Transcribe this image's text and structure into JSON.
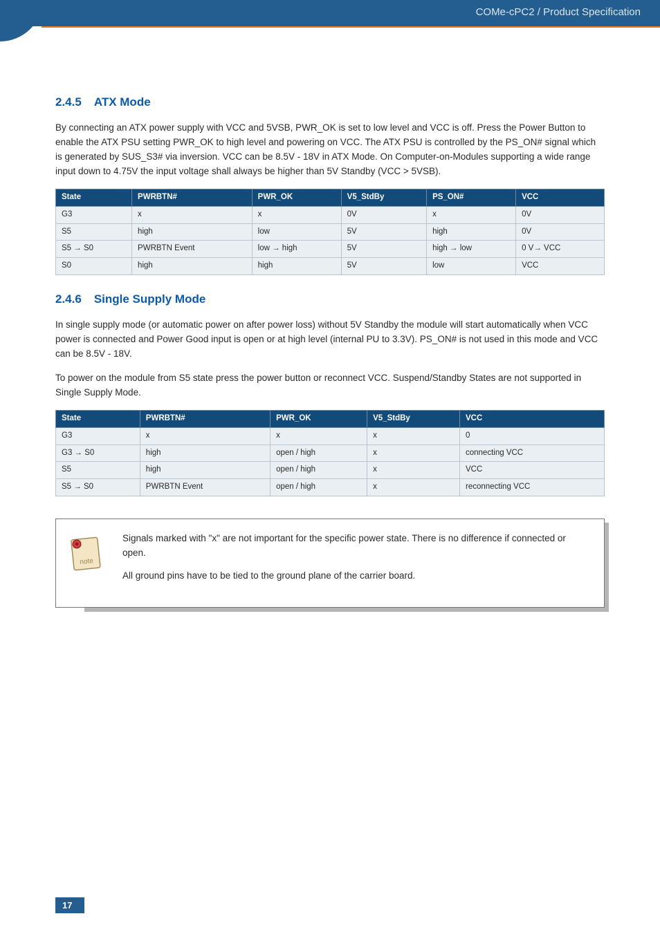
{
  "header": {
    "breadcrumb": "COMe-cPC2 / Product Specification"
  },
  "s1": {
    "num": "2.4.5",
    "title": "ATX Mode",
    "para": "By connecting an ATX power supply with VCC and 5VSB, PWR_OK is set to low level and VCC is off. Press the Power Button to enable the ATX PSU setting PWR_OK to high level and powering on VCC. The ATX PSU is controlled by the PS_ON# signal which is generated by SUS_S3# via inversion. VCC can be 8.5V - 18V in ATX Mode. On Computer-on-Modules supporting a wide range input down to 4.75V the input voltage shall always be higher than 5V Standby (VCC > 5VSB).",
    "table": {
      "headers": [
        "State",
        "PWRBTN#",
        "PWR_OK",
        "V5_StdBy",
        "PS_ON#",
        "VCC"
      ],
      "rows": [
        [
          "G3",
          "x",
          "x",
          "0V",
          "x",
          "0V"
        ],
        [
          "S5",
          "high",
          "low",
          "5V",
          "high",
          "0V"
        ],
        [
          "S5 → S0",
          "PWRBTN Event",
          "low → high",
          "5V",
          "high → low",
          "0 V→ VCC"
        ],
        [
          "S0",
          "high",
          "high",
          "5V",
          "low",
          "VCC"
        ]
      ]
    }
  },
  "s2": {
    "num": "2.4.6",
    "title": "Single Supply Mode",
    "para1": "In single supply mode (or automatic power on after power loss) without 5V Standby the module will start automatically when VCC power is connected and Power Good input is open or at high level (internal PU to 3.3V). PS_ON# is not used in this mode and VCC can be 8.5V - 18V.",
    "para2": "To power on the module from S5 state press the power button or reconnect VCC. Suspend/Standby States are not supported in Single Supply Mode.",
    "table": {
      "headers": [
        "State",
        "PWRBTN#",
        "PWR_OK",
        "V5_StdBy",
        "VCC"
      ],
      "rows": [
        [
          "G3",
          "x",
          "x",
          "x",
          "0"
        ],
        [
          "G3 → S0",
          "high",
          "open / high",
          "x",
          "connecting VCC"
        ],
        [
          "S5",
          "high",
          "open / high",
          "x",
          "VCC"
        ],
        [
          "S5 → S0",
          "PWRBTN Event",
          "open / high",
          "x",
          "reconnecting VCC"
        ]
      ]
    }
  },
  "note": {
    "p1": "Signals marked with \"x\" are not important for the specific power state. There is no difference if connected or open.",
    "p2": "All ground pins have to be tied to the ground plane of the carrier board."
  },
  "footer": {
    "page": "17"
  }
}
